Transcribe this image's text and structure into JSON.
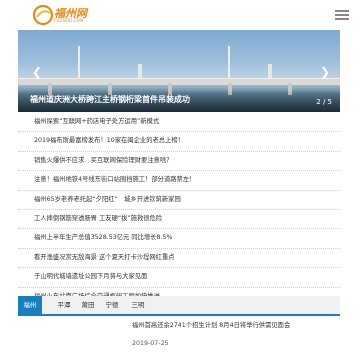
{
  "header": {
    "logo_text": "福州网",
    "logo_sub": "FUZHOU.COM",
    "menu_icon": "menu-icon"
  },
  "banner": {
    "title": "福州道庆洲大桥跨江主桥钢桁梁首件吊装成功",
    "page_indicator": "2 / 5"
  },
  "news": [
    "福州探索“互联网+药店电子处方运用”新模式",
    "2019福布斯最富榜发布！10家在闽企业的老总上榜！",
    "销售火爆供不应求　买互联网保险理财要注意啥？",
    "注意！福州地铁4号线东街口站围挡施工！部分道路禁左！",
    "福州65岁老养老托起“夕阳红”　城乡开进钦筑新家园",
    "工人摔倒钢筋穿透肠胃 工友硬“拔”施救很危险",
    "福州上半年生产总值3528.53亿元 同比增长8.5%",
    "看开渔盛况赏无敌海景 这个夏天打卡沙埕网红重点",
    "于山明代城墙遗址公园下月将与大家见面",
    "福州火车站南广场综合交通枢纽工程加快推进"
  ],
  "region_tabs": [
    "福州",
    "平潭",
    "莆田",
    "宁德",
    "三明"
  ],
  "bottom_news": {
    "title": "福州首高还余2741个招生计划 8月4日将举行供需见面会",
    "date": "2019-07-25"
  }
}
